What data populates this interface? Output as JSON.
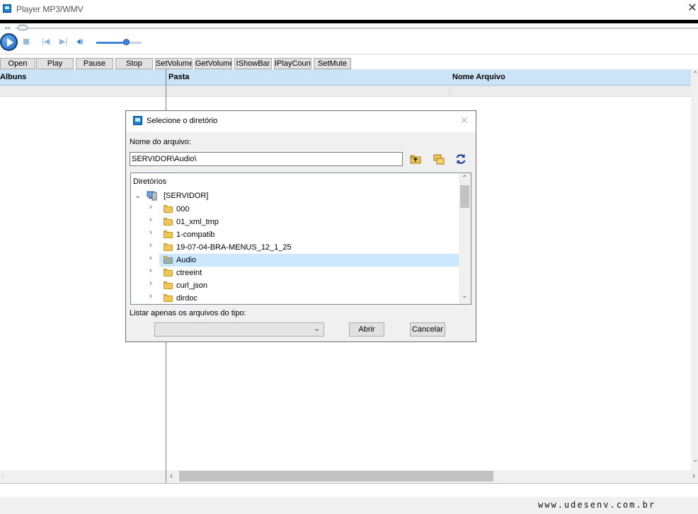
{
  "window": {
    "title": "Player MP3/WMV",
    "close_glyph": "✕"
  },
  "player": {
    "seek_position": 0.01,
    "volume_level": 0.66,
    "controls": [
      "play-icon",
      "stop-icon",
      "previous-icon",
      "next-icon",
      "volume-icon"
    ]
  },
  "toolbar": {
    "buttons": [
      "Open",
      "Play",
      "Pause",
      "Stop",
      "SetVolume",
      "GetVolume",
      "IShowBar",
      "IPlayCount",
      "SetMute"
    ]
  },
  "grid": {
    "left_header": "Albuns",
    "right_headers": [
      "Pasta",
      "Nome Arquivo"
    ]
  },
  "dialog": {
    "title": "Selecione o diretório",
    "filename_label": "Nome do arquivo:",
    "filename_value": "SERVIDOR\\Audio\\",
    "tree_label": "Diretórios",
    "root": "[SERVIDOR]",
    "folders": [
      "000",
      "01_xml_tmp",
      "1-compatib",
      "19-07-04-BRA-MENUS_12_1_25",
      "Audio",
      "ctreeint",
      "curl_json",
      "dirdoc"
    ],
    "selected_folder": "Audio",
    "filter_label": "Listar apenas os arquivos do tipo:",
    "filter_value": "",
    "open_button": "Abrir",
    "cancel_button": "Cancelar",
    "toolbar_icons": [
      "folder-up-icon",
      "folder-copy-icon",
      "refresh-icon"
    ]
  },
  "footer": {
    "url": "www.udesenv.com.br"
  },
  "colors": {
    "header_blue": "#cbe3f7",
    "selection": "#cce8ff",
    "accent": "#1a64b8"
  }
}
